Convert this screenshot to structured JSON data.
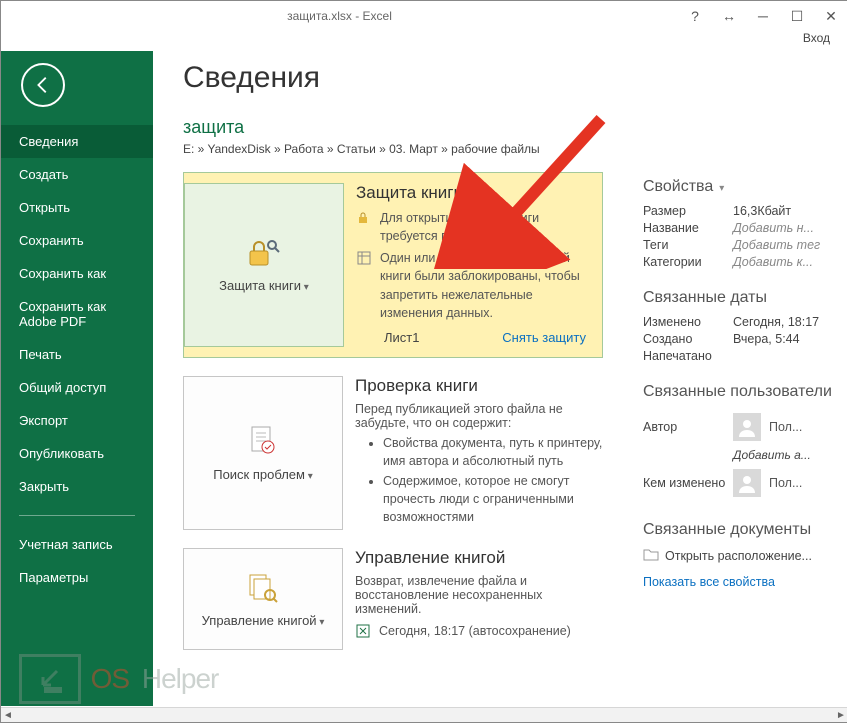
{
  "window": {
    "title": "защита.xlsx - Excel",
    "login": "Вход"
  },
  "sidebar": {
    "items": [
      "Сведения",
      "Создать",
      "Открыть",
      "Сохранить",
      "Сохранить как",
      "Сохранить как Adobe PDF",
      "Печать",
      "Общий доступ",
      "Экспорт",
      "Опубликовать",
      "Закрыть"
    ],
    "footer": [
      "Учетная запись",
      "Параметры"
    ]
  },
  "page": {
    "heading": "Сведения",
    "doc": "защита",
    "breadcrumb": "E: » YandexDisk » Работа » Статьи » 03. Март » рабочие файлы"
  },
  "protect": {
    "title": "Защита книги",
    "button": "Защита книги",
    "msg1": "Для открытия данной книги требуется пароль.",
    "msg2": "Один или несколько листов этой книги были заблокированы, чтобы запретить нежелательные изменения данных.",
    "sheet": "Лист1",
    "unprotect": "Снять защиту"
  },
  "inspect": {
    "title": "Проверка книги",
    "button": "Поиск проблем",
    "intro": "Перед публикацией этого файла не забудьте, что он содержит:",
    "bullets": [
      "Свойства документа, путь к принтеру, имя автора и абсолютный путь",
      "Содержимое, которое не смогут прочесть люди с ограниченными возможностями"
    ]
  },
  "manage": {
    "title": "Управление книгой",
    "button": "Управление книгой",
    "intro": "Возврат, извлечение файла и восстановление несохраненных изменений.",
    "version": "Сегодня, 18:17 (автосохранение)"
  },
  "props": {
    "heading": "Свойства",
    "size_k": "Размер",
    "size_v": "16,3Кбайт",
    "name_k": "Название",
    "name_v": "Добавить н...",
    "tags_k": "Теги",
    "tags_v": "Добавить тег",
    "cat_k": "Категории",
    "cat_v": "Добавить к..."
  },
  "dates": {
    "heading": "Связанные даты",
    "mod_k": "Изменено",
    "mod_v": "Сегодня, 18:17",
    "created_k": "Создано",
    "created_v": "Вчера, 5:44",
    "printed_k": "Напечатано",
    "printed_v": ""
  },
  "people": {
    "heading": "Связанные пользователи",
    "author_k": "Автор",
    "author_v": "Пол...",
    "add_author": "Добавить а...",
    "modby_k": "Кем изменено",
    "modby_v": "Пол..."
  },
  "related": {
    "heading": "Связанные документы",
    "open_loc": "Открыть расположение...",
    "show_all": "Показать все свойства"
  },
  "watermark": {
    "a": "OS",
    "b": " Helper"
  }
}
